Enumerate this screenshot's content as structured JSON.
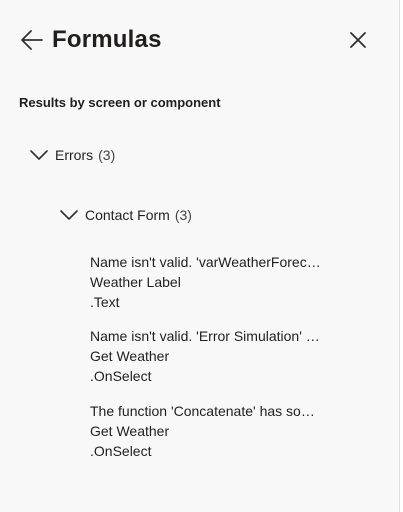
{
  "header": {
    "title": "Formulas"
  },
  "section_label": "Results by screen or component",
  "groups": {
    "errors": {
      "label": "Errors",
      "count": "(3)"
    },
    "contact_form": {
      "label": "Contact Form",
      "count": "(3)"
    }
  },
  "errors": [
    {
      "message": "Name isn't valid. 'varWeatherForec…",
      "control": "Weather Label",
      "property": ".Text"
    },
    {
      "message": "Name isn't valid. 'Error Simulation' …",
      "control": "Get Weather",
      "property": ".OnSelect"
    },
    {
      "message": "The function 'Concatenate' has so…",
      "control": "Get Weather",
      "property": ".OnSelect"
    }
  ],
  "icons": {
    "back": "arrow-left-icon",
    "close": "close-icon",
    "expand": "chevron-down-icon"
  },
  "colors": {
    "panel_bg": "#f8f8f8",
    "text": "#201f1e"
  }
}
